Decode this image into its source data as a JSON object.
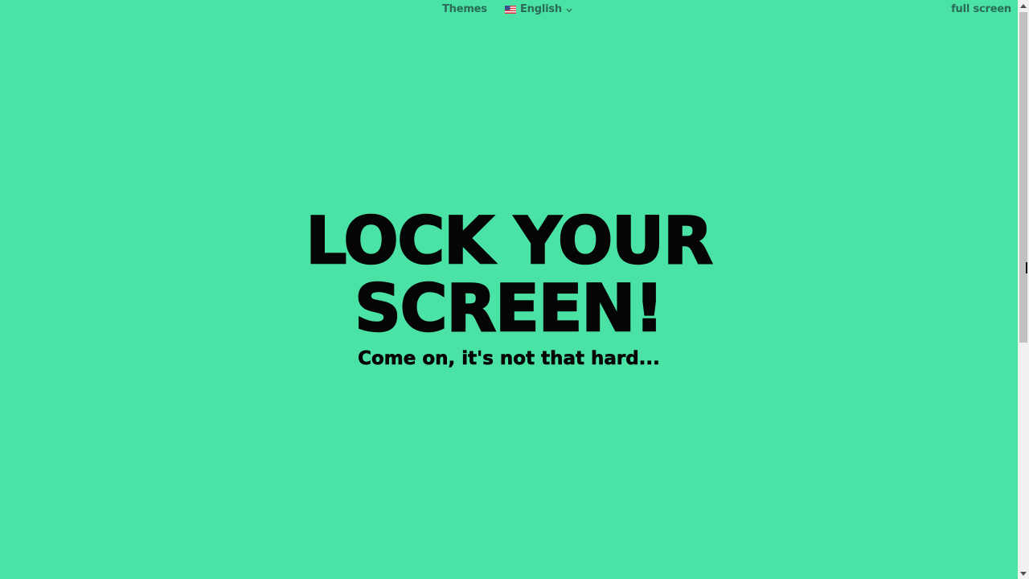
{
  "nav": {
    "themes_label": "Themes",
    "language_label": "English",
    "fullscreen_label": "full screen"
  },
  "hero": {
    "title_line1": "LOCK YOUR",
    "title_line2": "SCREEN!",
    "subtitle": "Come on, it's not that hard..."
  },
  "colors": {
    "background": "#4be3a5",
    "nav_text": "#2a6a58",
    "hero_text": "#050505"
  },
  "icons": {
    "language": "us-flag-icon",
    "dropdown": "chevron-down-icon",
    "scroll_up": "arrow-up-icon",
    "scroll_down": "arrow-down-icon"
  }
}
